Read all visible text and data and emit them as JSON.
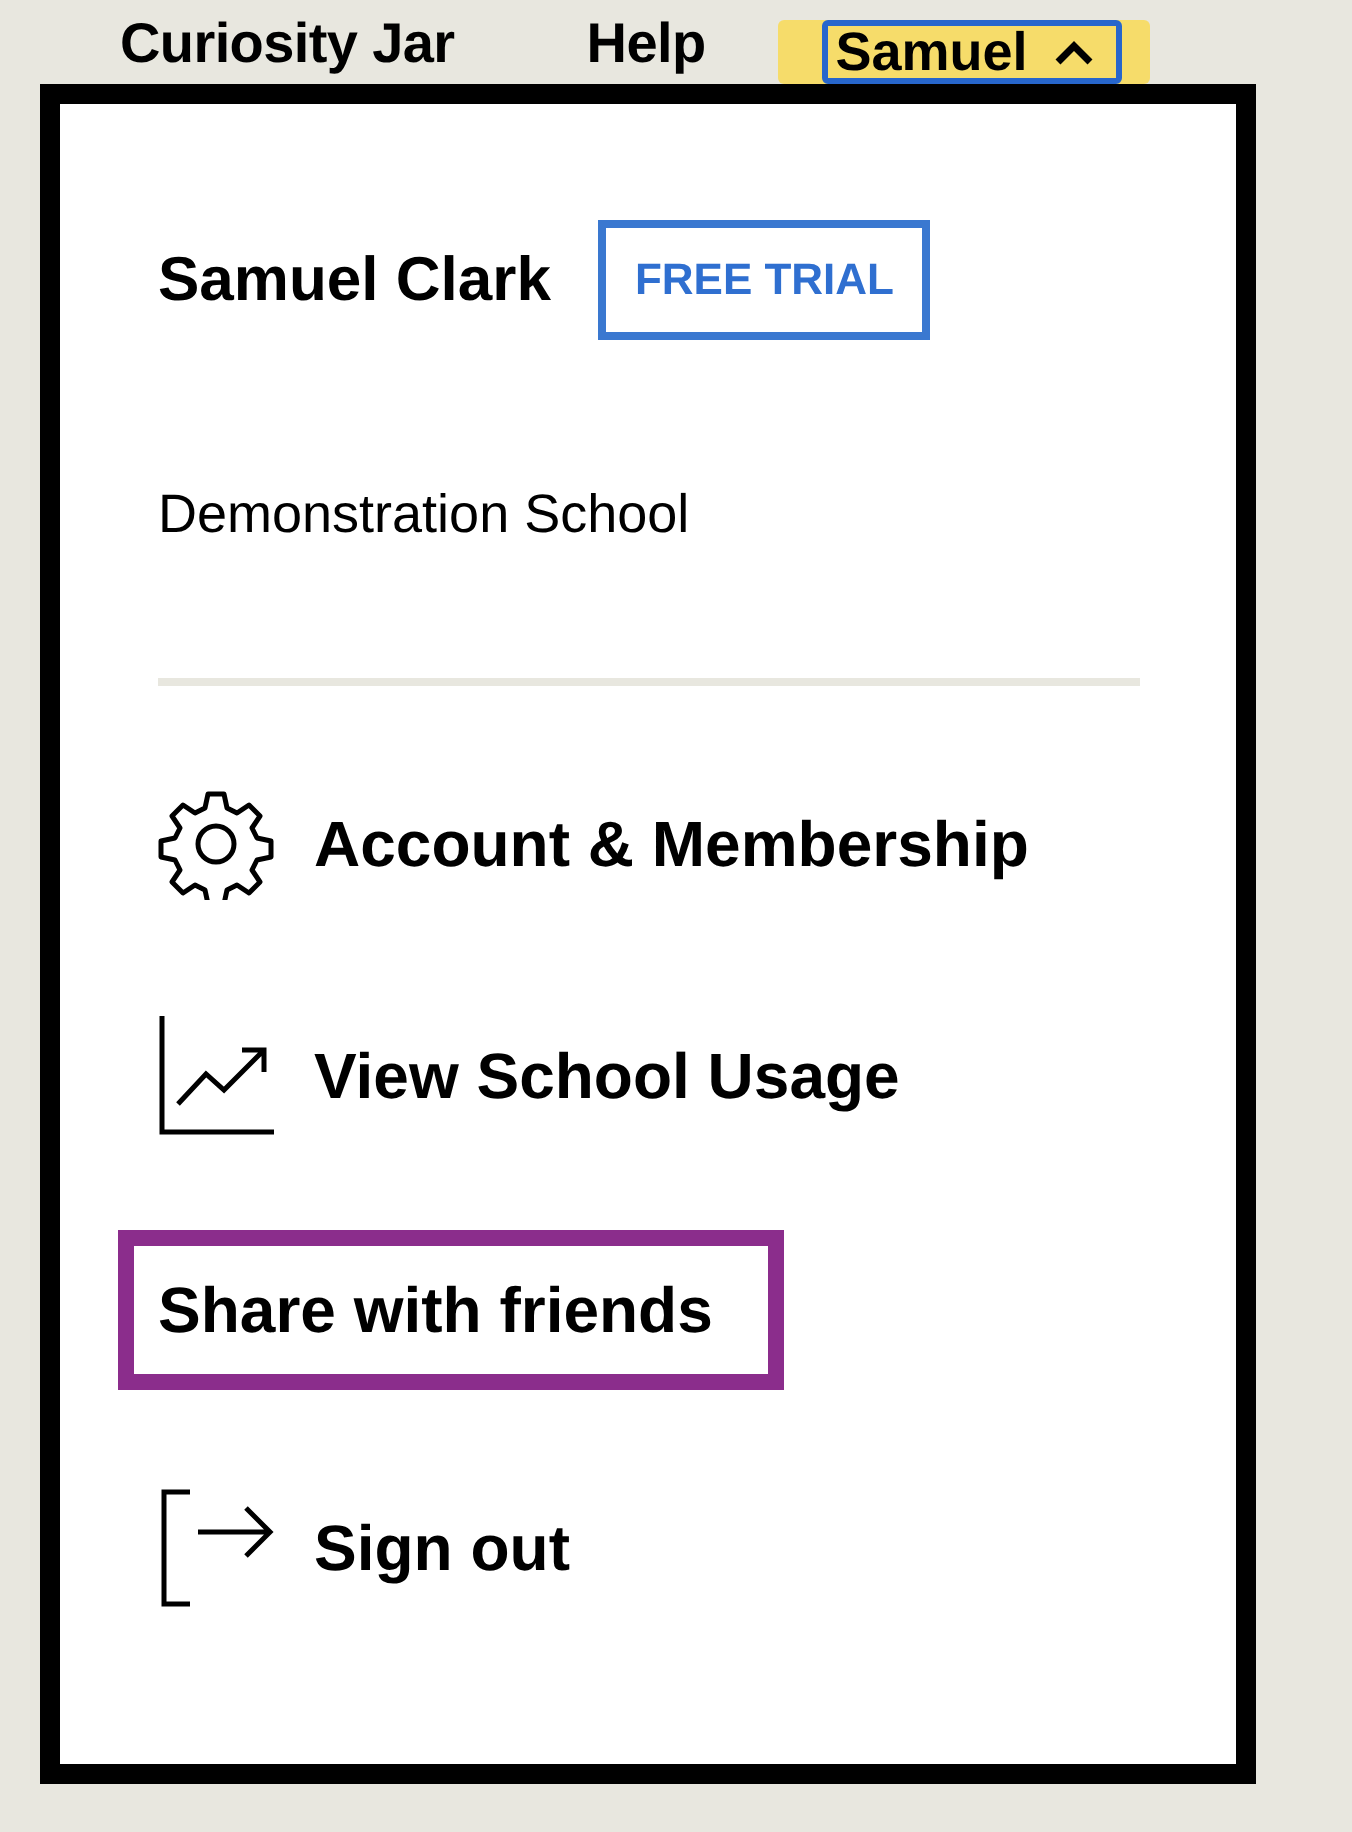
{
  "nav": {
    "links": [
      "Curiosity Jar",
      "Help"
    ],
    "account_button": {
      "label": "Samuel",
      "expanded": true
    }
  },
  "menu": {
    "user_name": "Samuel Clark",
    "badge": "FREE TRIAL",
    "school": "Demonstration School",
    "items": [
      {
        "kind": "gear",
        "label": "Account & Membership",
        "selected": false
      },
      {
        "kind": "chart",
        "label": "View School Usage",
        "selected": false
      },
      {
        "kind": "none",
        "label": "Share with friends",
        "selected": true
      },
      {
        "kind": "signout",
        "label": "Sign out",
        "selected": false
      }
    ]
  }
}
